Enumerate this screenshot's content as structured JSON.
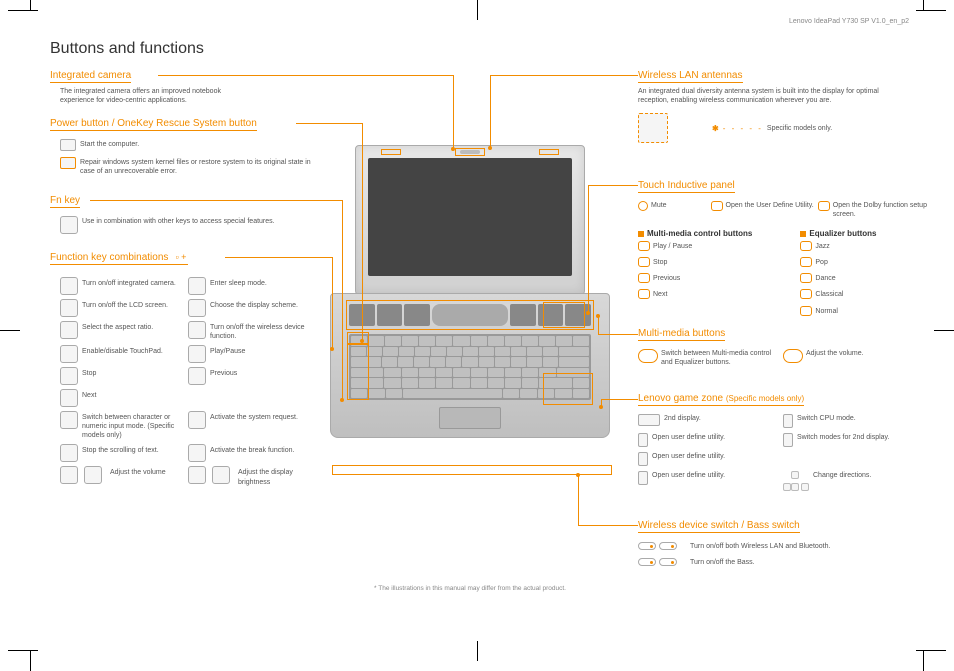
{
  "doc_id": "Lenovo IdeaPad Y730 SP V1.0_en_p2",
  "page_title": "Buttons and functions",
  "footnote": "* The illustrations in this manual may differ from the actual product.",
  "sections": {
    "integrated_camera": {
      "heading": "Integrated camera",
      "body": "The integrated camera offers an improved notebook experience for video-centric applications."
    },
    "power_button": {
      "heading": "Power button / OneKey Rescue System button",
      "item1": "Start the computer.",
      "item2": "Repair windows system kernel files or restore system to its original state in case of an unrecoverable error."
    },
    "fn_key": {
      "heading": "Fn key",
      "body": "Use in combination with other keys to access special features."
    },
    "fn_combos": {
      "heading": "Function key combinations",
      "items": [
        "Turn on/off integrated camera.",
        "Enter sleep mode.",
        "Turn on/off the LCD screen.",
        "Choose the display scheme.",
        "Select the aspect ratio.",
        "Turn on/off the wireless device function.",
        "Enable/disable TouchPad.",
        "Play/Pause",
        "Stop",
        "Previous",
        "Next",
        "",
        "Switch between character or numeric input mode. (Specific models only)",
        "Activate the system request.",
        "Stop the scrolling of text.",
        "Activate the break function.",
        "Adjust the volume",
        "Adjust the display brightness"
      ]
    },
    "wlan": {
      "heading": "Wireless LAN antennas",
      "body": "An integrated dual diversity antenna system is built into the display for optimal reception, enabling wireless communication wherever you are.",
      "legend": "Specific models only."
    },
    "touch_panel": {
      "heading": "Touch Inductive panel",
      "row1": [
        {
          "label": "Mute"
        },
        {
          "label": "Open the User Define Utility."
        },
        {
          "label": "Open the Dolby function setup screen."
        }
      ],
      "sub1": "Multi-media control buttons",
      "sub2": "Equalizer buttons",
      "media": [
        "Play / Pause",
        "Stop",
        "Previous",
        "Next"
      ],
      "eq": [
        "Jazz",
        "Pop",
        "Dance",
        "Classical",
        "Normal"
      ]
    },
    "multimedia": {
      "heading": "Multi-media buttons",
      "item1": "Switch between Multi-media control and Equalizer buttons.",
      "item2": "Adjust the volume."
    },
    "game_zone": {
      "heading": "Lenovo game zone",
      "heading_sub": "(Specific models only)",
      "rows": [
        "2nd display.",
        "Switch CPU mode.",
        "Open user define utility.",
        "Switch modes for 2nd display.",
        "Open user define utility.",
        "",
        "Open user define utility.",
        "Change directions."
      ]
    },
    "wireless_switch": {
      "heading": "Wireless device switch / Bass switch",
      "item1": "Turn on/off both Wireless LAN and Bluetooth.",
      "item2": "Turn on/off the Bass."
    }
  }
}
